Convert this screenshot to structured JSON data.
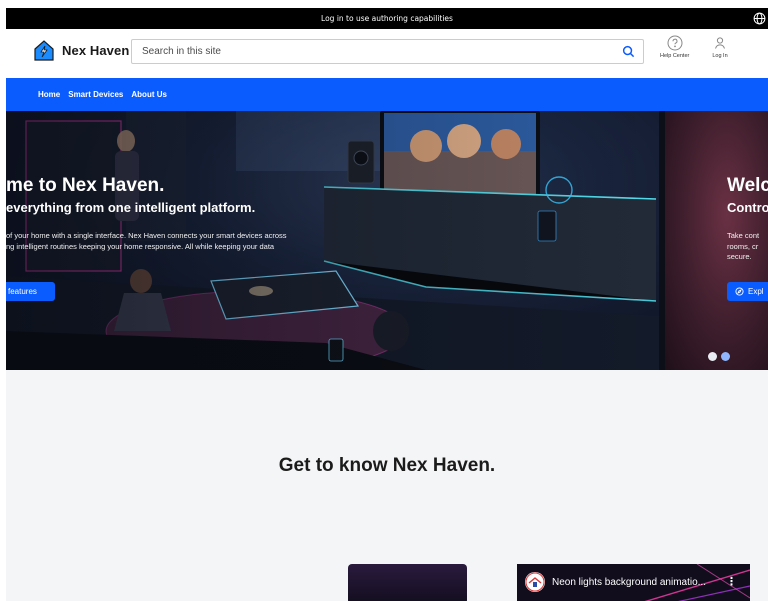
{
  "topbar": {
    "message": "Log in to use authoring capabilities",
    "icon": "globe-icon"
  },
  "header": {
    "logo_text": "Nex Haven",
    "search": {
      "placeholder": "Search in this site",
      "value": ""
    },
    "help_label": "Help Center",
    "login_label": "Log In"
  },
  "nav": {
    "items": [
      {
        "label": "Home"
      },
      {
        "label": "Smart Devices"
      },
      {
        "label": "About Us"
      }
    ]
  },
  "hero": {
    "slide1": {
      "title": "me to Nex Haven.",
      "subtitle": "everything from one intelligent platform.",
      "body_line1": "of your home with a single interface. Nex Haven connects your smart devices across",
      "body_line2": "ng intelligent routines keeping your home responsive. All while keeping your data",
      "button": "features"
    },
    "slide2": {
      "title": "Welc",
      "subtitle": "Contro",
      "body_line1": "Take cont",
      "body_line2": "rooms, cr",
      "body_line3": "secure.",
      "button": "Expl"
    },
    "pagination": {
      "count": 2,
      "active": 1
    }
  },
  "section": {
    "title": "Get to know Nex Haven."
  },
  "video": {
    "title": "Neon lights background animatio..."
  },
  "colors": {
    "brand_blue": "#0b5cff",
    "topbar": "#000000",
    "page_bg": "#f4f5f7"
  }
}
